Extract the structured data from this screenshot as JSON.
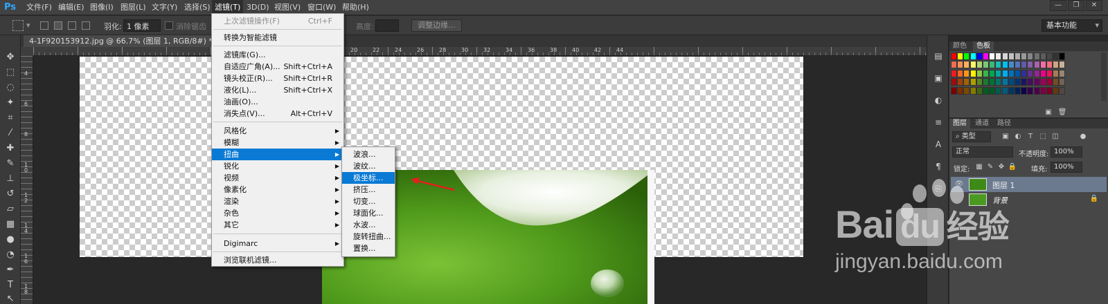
{
  "app": {
    "logo": "Ps"
  },
  "menubar": {
    "items": [
      "文件(F)",
      "编辑(E)",
      "图像(I)",
      "图层(L)",
      "文字(Y)",
      "选择(S)",
      "滤镜(T)",
      "3D(D)",
      "视图(V)",
      "窗口(W)",
      "帮助(H)"
    ],
    "active": "滤镜(T)"
  },
  "window_controls": {
    "minimize": "—",
    "restore": "❐",
    "close": "✕"
  },
  "optionsbar": {
    "feather_label": "羽化:",
    "feather_value": "1 像素",
    "antialias_label": "消除锯齿",
    "height_label": "高度:",
    "refine_edge_button": "调整边缘...",
    "workspace": "基本功能"
  },
  "document_tab": {
    "title": "4-1F920153912.jpg @ 66.7% (图层 1, RGB/8#) *",
    "close": "×"
  },
  "ruler": {
    "top_labels": [
      "20",
      "22",
      "24",
      "26",
      "28",
      "30",
      "32",
      "34",
      "36",
      "38",
      "40",
      "42",
      "44"
    ],
    "left_labels": [
      "4",
      "6",
      "8",
      "1\n0",
      "1\n2",
      "1\n4",
      "1\n6",
      "1\n8"
    ]
  },
  "filter_menu": {
    "items": [
      {
        "label": "上次滤镜操作(F)",
        "shortcut": "Ctrl+F",
        "disabled": true
      },
      {
        "label": "转换为智能滤镜"
      },
      {
        "label": "滤镜库(G)..."
      },
      {
        "label": "自适应广角(A)...",
        "shortcut": "Shift+Ctrl+A"
      },
      {
        "label": "镜头校正(R)...",
        "shortcut": "Shift+Ctrl+R"
      },
      {
        "label": "液化(L)...",
        "shortcut": "Shift+Ctrl+X"
      },
      {
        "label": "油画(O)..."
      },
      {
        "label": "消失点(V)...",
        "shortcut": "Alt+Ctrl+V"
      },
      {
        "label": "风格化",
        "submenu": true
      },
      {
        "label": "模糊",
        "submenu": true
      },
      {
        "label": "扭曲",
        "submenu": true,
        "highlighted": true
      },
      {
        "label": "锐化",
        "submenu": true
      },
      {
        "label": "视频",
        "submenu": true
      },
      {
        "label": "像素化",
        "submenu": true
      },
      {
        "label": "渲染",
        "submenu": true
      },
      {
        "label": "杂色",
        "submenu": true
      },
      {
        "label": "其它",
        "submenu": true
      },
      {
        "label": "Digimarc",
        "submenu": true
      },
      {
        "label": "浏览联机滤镜..."
      }
    ]
  },
  "distort_submenu": {
    "items": [
      "波浪...",
      "波纹...",
      "极坐标...",
      "挤压...",
      "切变...",
      "球面化...",
      "水波...",
      "旋转扭曲...",
      "置换..."
    ],
    "highlighted": "极坐标..."
  },
  "color_panel": {
    "tabs": [
      "颜色",
      "色板"
    ],
    "active_tab": "色板",
    "swatches": [
      "#ff0000",
      "#ffff00",
      "#00ff00",
      "#00ffff",
      "#0000ff",
      "#ff00ff",
      "#ffffff",
      "#ebebeb",
      "#d6d6d6",
      "#c2c2c2",
      "#adadad",
      "#999999",
      "#858585",
      "#707070",
      "#5c5c5c",
      "#474747",
      "#333333",
      "#000000",
      "#f26c4f",
      "#f68e55",
      "#fbaf5c",
      "#fff467",
      "#acd372",
      "#7cc576",
      "#3bb878",
      "#1abbb4",
      "#00bff3",
      "#438ccb",
      "#5574b9",
      "#605ca8",
      "#855fa8",
      "#a763a8",
      "#f06ea9",
      "#f26d7d",
      "#d1a183",
      "#c7b299",
      "#ed1c24",
      "#f26522",
      "#f7941d",
      "#fff200",
      "#8dc63f",
      "#39b54a",
      "#00a651",
      "#00a99d",
      "#00aeef",
      "#0072bc",
      "#0054a6",
      "#2e3192",
      "#662d91",
      "#92278f",
      "#ec008c",
      "#ed145b",
      "#a67c52",
      "#998675",
      "#9e0b0f",
      "#a0410d",
      "#a36209",
      "#aba000",
      "#598527",
      "#1a7b30",
      "#007236",
      "#00746b",
      "#0076a3",
      "#004b80",
      "#003471",
      "#1b1464",
      "#440e62",
      "#630460",
      "#9e005d",
      "#9e0039",
      "#754c24",
      "#736357",
      "#790000",
      "#7b2e00",
      "#7d4900",
      "#827b00",
      "#406618",
      "#005e20",
      "#005826",
      "#005952",
      "#005b7f",
      "#003663",
      "#002157",
      "#0d004c",
      "#32004b",
      "#4b0049",
      "#7b0046",
      "#7a0026",
      "#603913",
      "#534741"
    ]
  },
  "layers_panel": {
    "tabs": [
      "图层",
      "通道",
      "路径"
    ],
    "active_tab": "图层",
    "kind_filter": "类型",
    "blend_mode": "正常",
    "opacity_label": "不透明度:",
    "opacity_value": "100%",
    "lock_label": "锁定:",
    "fill_label": "填充:",
    "fill_value": "100%",
    "layers": [
      {
        "name": "图层 1",
        "selected": true
      },
      {
        "name": "背景",
        "locked": true
      }
    ]
  },
  "watermark": {
    "brand": "Bai",
    "brand_du": "du",
    "brand_cn": "经验",
    "url": "jingyan.baidu.com"
  }
}
